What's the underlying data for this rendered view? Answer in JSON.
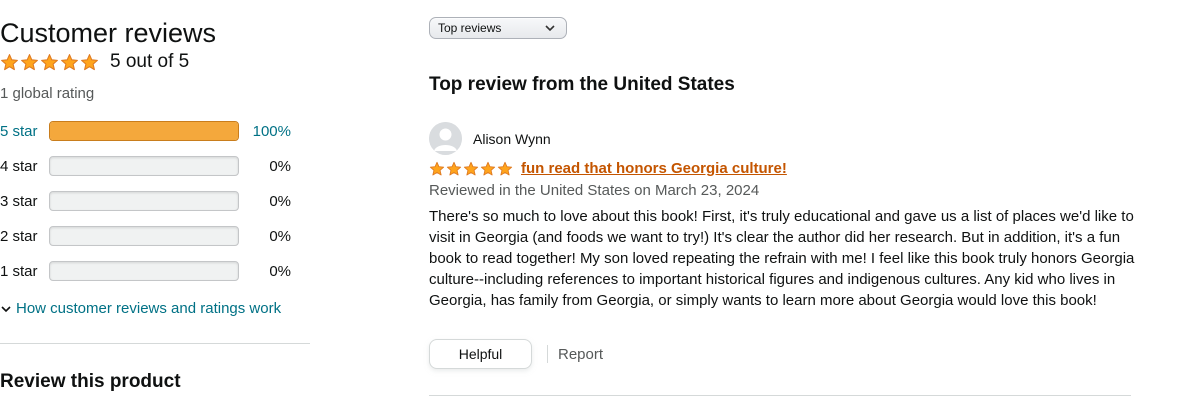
{
  "summary": {
    "heading": "Customer reviews",
    "out_of": "5 out of 5",
    "global_rating": "1 global rating",
    "stars_filled": 5,
    "how_link": "How customer reviews and ratings work"
  },
  "histogram": [
    {
      "label": "5 star",
      "percent": "100%",
      "value": 100
    },
    {
      "label": "4 star",
      "percent": "0%",
      "value": 0
    },
    {
      "label": "3 star",
      "percent": "0%",
      "value": 0
    },
    {
      "label": "2 star",
      "percent": "0%",
      "value": 0
    },
    {
      "label": "1 star",
      "percent": "0%",
      "value": 0
    }
  ],
  "review_product": {
    "heading": "Review this product"
  },
  "sort": {
    "selected": "Top reviews"
  },
  "top_review": {
    "section_title": "Top review from the United States",
    "reviewer": "Alison Wynn",
    "stars": 5,
    "title": "fun read that honors Georgia culture!",
    "date": "Reviewed in the United States on March 23, 2024",
    "body": "There's so much to love about this book! First, it's truly educational and gave us a list of places we'd like to visit in Georgia (and foods we want to try!) It's clear the author did her research. But in addition, it's a fun book to read together! My son loved repeating the refrain with me! I feel like this book truly honors Georgia culture--including references to important historical figures and indigenous cultures. Any kid who lives in Georgia, has family from Georgia, or simply wants to learn more about Georgia would love this book!",
    "helpful_label": "Helpful",
    "report_label": "Report"
  },
  "colors": {
    "star": "#ffa41c",
    "star_stroke": "#de7921",
    "link": "#007185",
    "title_link": "#c45500",
    "bar_fill": "#f4a83c"
  },
  "icons": {
    "star": "star-icon",
    "avatar": "default-avatar-icon",
    "chevron": "chevron-down-icon"
  }
}
